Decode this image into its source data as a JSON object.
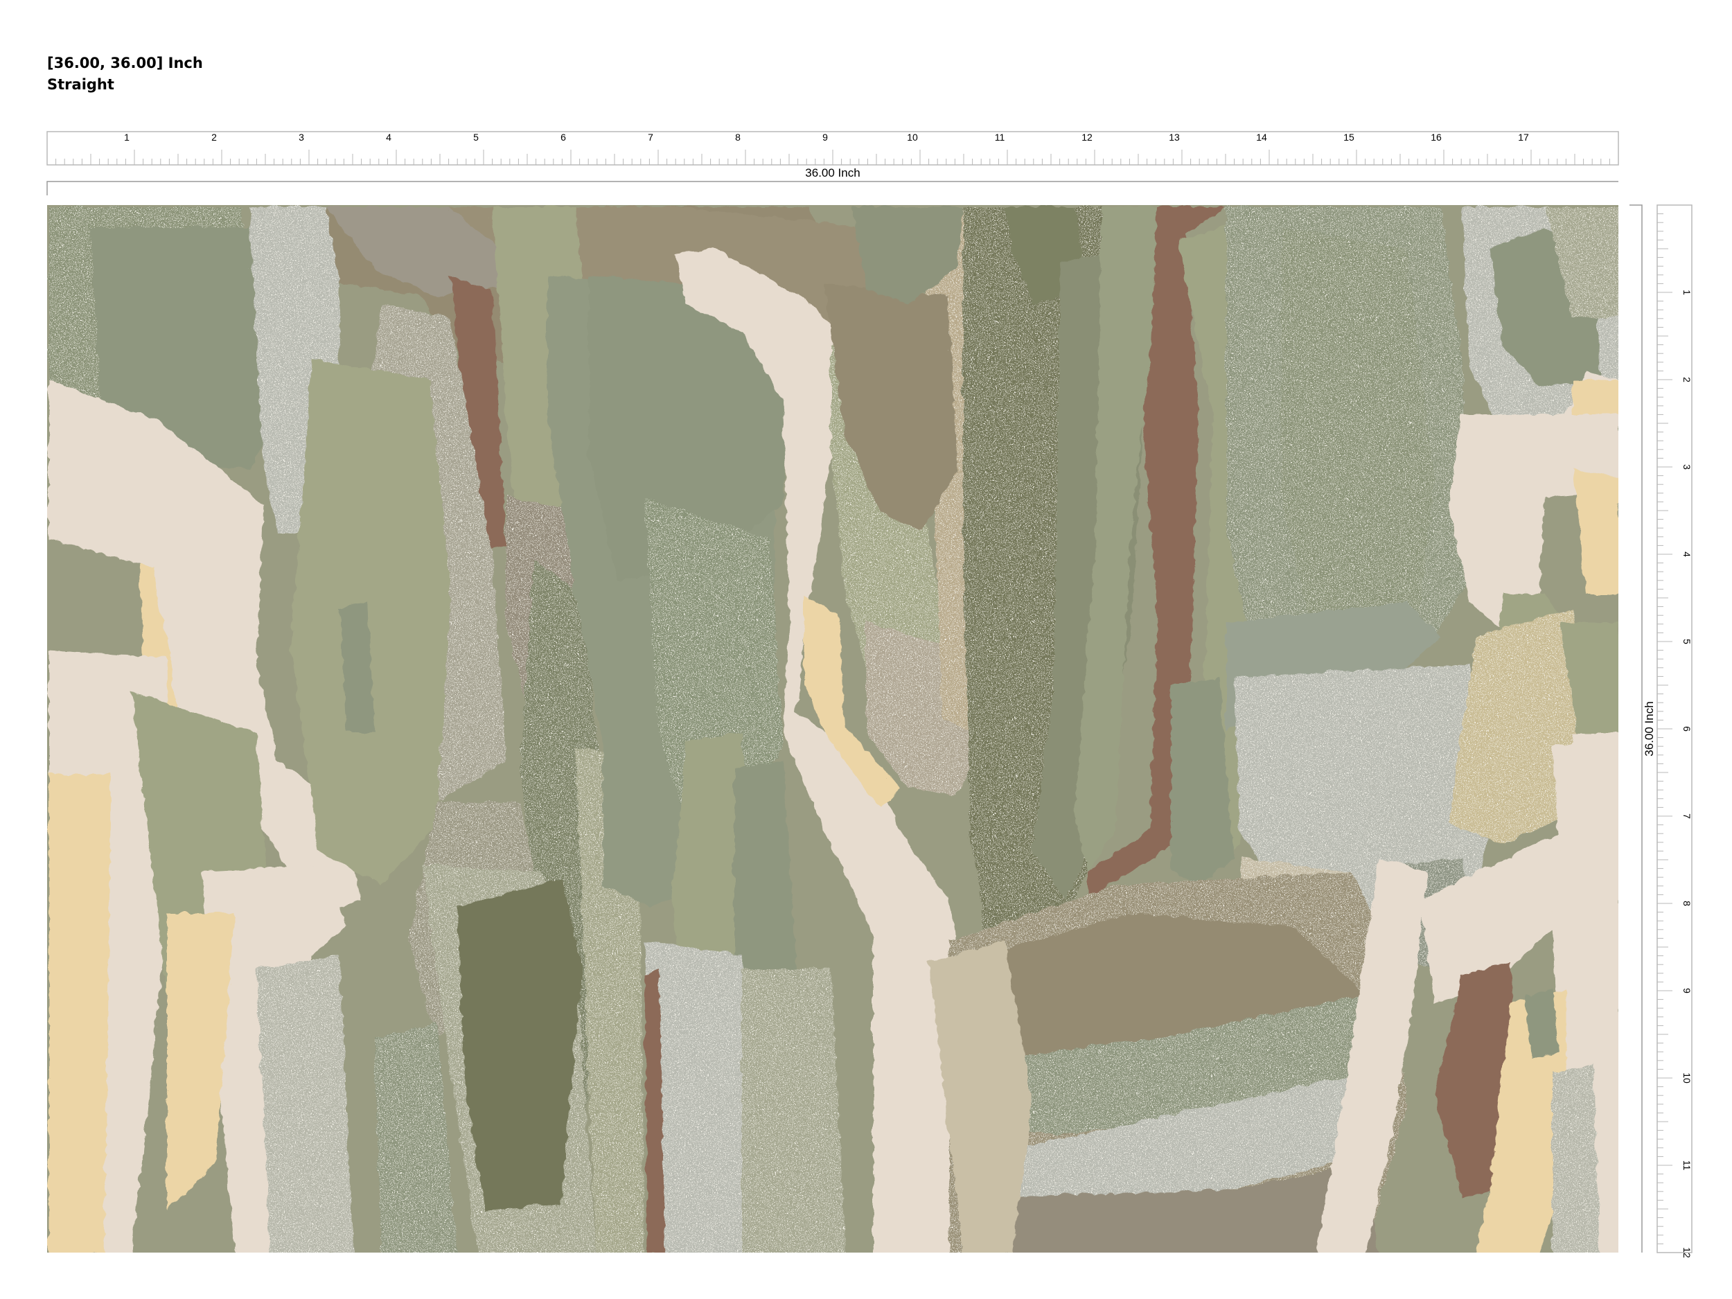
{
  "header": {
    "size_label": "[36.00, 36.00] Inch",
    "repeat_label": "Straight"
  },
  "ruler_top": {
    "ticks": [
      "1",
      "2",
      "3",
      "4",
      "5",
      "6",
      "7",
      "8",
      "9",
      "10",
      "11",
      "12",
      "13",
      "14",
      "15",
      "16",
      "17"
    ],
    "dimension_label": "36.00 Inch"
  },
  "ruler_right": {
    "ticks": [
      "1",
      "2",
      "3",
      "4",
      "5",
      "6",
      "7",
      "8",
      "9",
      "10",
      "11",
      "12"
    ],
    "dimension_label": "36.00 Inch"
  },
  "colors": {
    "base": "#9a9c82",
    "cream": "#e7dccf",
    "sand": "#ecd5a6",
    "sage": "#a0a585",
    "dark_olive": "#75785a",
    "grey_green": "#8f977f",
    "rust": "#8c6a58",
    "taupe": "#958b72",
    "stone": "#b7b8ab",
    "light_grey": "#b9bbb2"
  }
}
